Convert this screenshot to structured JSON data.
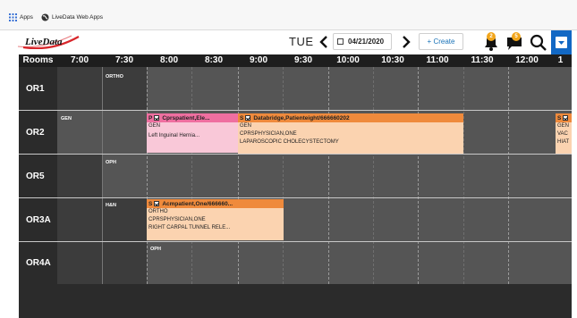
{
  "bookmarks": [
    {
      "label": "Apps",
      "icon": "apps-grid-icon"
    },
    {
      "label": "LiveData Web Apps",
      "icon": "globe-icon"
    }
  ],
  "app": {
    "logo_text": "LiveData"
  },
  "toolbar": {
    "day": "TUE",
    "date": "04/21/2020",
    "create_label": "+ Create",
    "alerts_badge": "2",
    "messages_badge": "5"
  },
  "grid": {
    "rooms_header": "Rooms",
    "times": [
      "7:00",
      "7:30",
      "8:00",
      "8:30",
      "9:00",
      "9:30",
      "10:00",
      "10:30",
      "11:00",
      "11:30",
      "12:00",
      "1"
    ],
    "rooms": [
      {
        "name": "OR1",
        "service": "ORTHO"
      },
      {
        "name": "OR2",
        "service": "GEN"
      },
      {
        "name": "OR5",
        "service": "OPH"
      },
      {
        "name": "OR3A",
        "service": "H&N"
      },
      {
        "name": "OR4A",
        "service": "OPH"
      }
    ],
    "cases": [
      {
        "status": "P",
        "title": "Cprspatient,Ele...",
        "lines": [
          "GEN",
          "Left Inguinal Hernia..."
        ],
        "header_color": "#ef6fa0",
        "body_color": "#f9c8d8"
      },
      {
        "status": "S",
        "title": "Databridge,Patienteight/666660202",
        "lines": [
          "GEN",
          "CPRSPHYSICIAN,ONE",
          "LAPAROSCOPIC CHOLECYSTECTOMY"
        ],
        "header_color": "#ef8a3c",
        "body_color": "#fbd3b0"
      },
      {
        "status": "S",
        "title": "",
        "lines": [
          "GEN",
          "VAC",
          "HIAT"
        ],
        "header_color": "#ef8a3c",
        "body_color": "#fbd3b0"
      },
      {
        "status": "S",
        "title": "Acmpatient,One/666660...",
        "lines": [
          "ORTHO",
          "CPRSPHYSICIAN,ONE",
          "RIGHT CARPAL TUNNEL RELE..."
        ],
        "header_color": "#ef8a3c",
        "body_color": "#fbd3b0"
      }
    ]
  },
  "colors": {
    "accent": "#1268c4",
    "header_bg": "#1e1e1e",
    "lane_bg": "#555555",
    "badge": "#f2a51a"
  }
}
